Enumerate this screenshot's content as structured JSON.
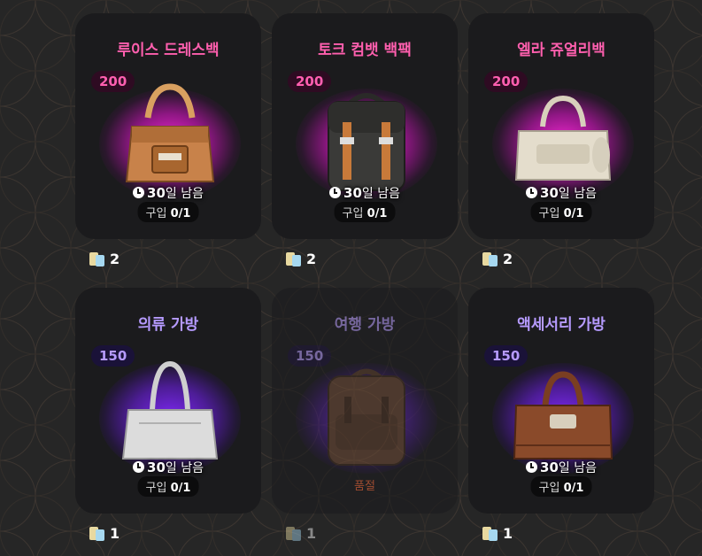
{
  "items": [
    {
      "name": "루이스 드레스백",
      "points": "200",
      "time_num": "30",
      "time_unit": "일 남음",
      "buy_label": "구입",
      "buy_count": "0/1",
      "price": "2",
      "status": "available",
      "rarity": "pink",
      "bag_color": "#c8824a"
    },
    {
      "name": "토크 컴뱃 백팩",
      "points": "200",
      "time_num": "30",
      "time_unit": "일 남음",
      "buy_label": "구입",
      "buy_count": "0/1",
      "price": "2",
      "status": "available",
      "rarity": "pink",
      "bag_color": "#3a3a38"
    },
    {
      "name": "엘라 쥬얼리백",
      "points": "200",
      "time_num": "30",
      "time_unit": "일 남음",
      "buy_label": "구입",
      "buy_count": "0/1",
      "price": "2",
      "status": "available",
      "rarity": "pink",
      "bag_color": "#e4ddcc"
    },
    {
      "name": "의류 가방",
      "points": "150",
      "time_num": "30",
      "time_unit": "일 남음",
      "buy_label": "구입",
      "buy_count": "0/1",
      "price": "1",
      "status": "available",
      "rarity": "purple",
      "bag_color": "#dcdcdc"
    },
    {
      "name": "여행 가방",
      "points": "150",
      "sold_label": "품절",
      "price": "1",
      "status": "sold-out",
      "rarity": "purple",
      "bag_color": "#6d4a35"
    },
    {
      "name": "액세서리 가방",
      "points": "150",
      "time_num": "30",
      "time_unit": "일 남음",
      "buy_label": "구입",
      "buy_count": "0/1",
      "price": "1",
      "status": "available",
      "rarity": "purple",
      "bag_color": "#8a4a2a"
    }
  ],
  "colors": {
    "pink_accent": "#ff5fae",
    "purple_accent": "#b69bff",
    "sold_out": "#ff6a3a",
    "background": "#262626",
    "card": "#1b1b1d"
  },
  "icons": {
    "clock": "clock-icon",
    "currency": "rp-coin-icon"
  }
}
